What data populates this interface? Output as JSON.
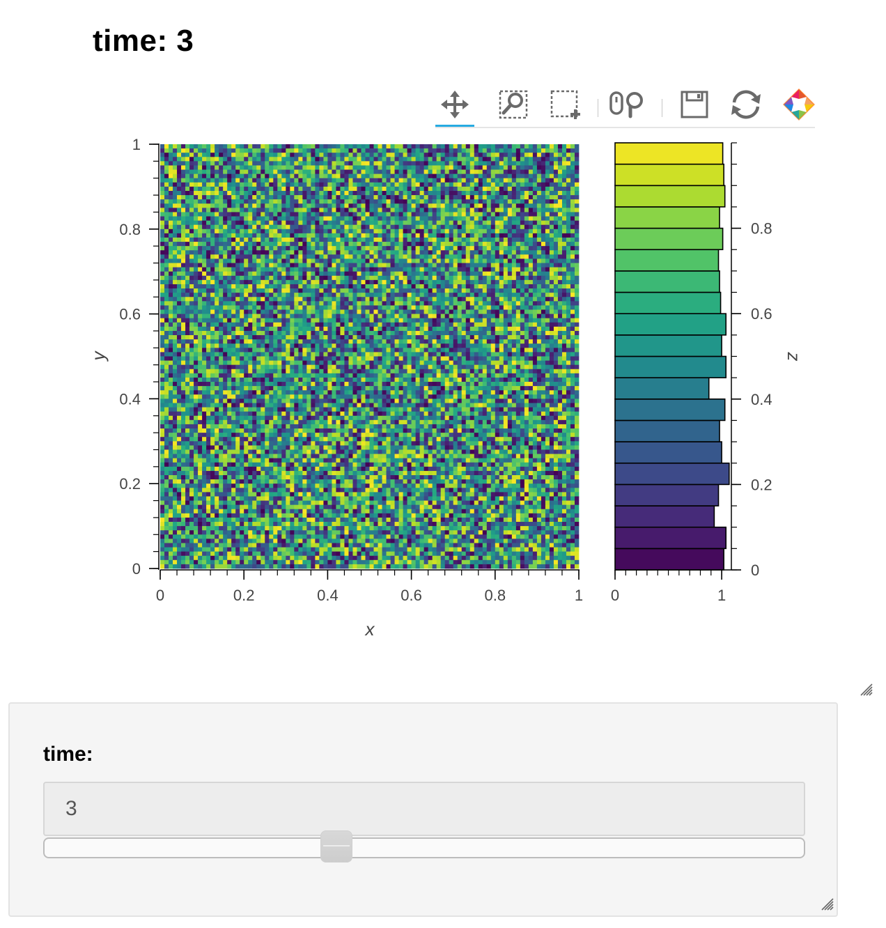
{
  "title": "time: 3",
  "toolbar": {
    "tools": [
      {
        "name": "pan-tool",
        "icon": "pan-icon",
        "active": true
      },
      {
        "name": "box-zoom-tool",
        "icon": "box-zoom-icon",
        "active": false
      },
      {
        "name": "box-select-tool",
        "icon": "box-select-icon",
        "active": false
      },
      {
        "name": "wheel-zoom-tool",
        "icon": "wheel-zoom-icon",
        "active": false
      },
      {
        "name": "save-tool",
        "icon": "save-icon",
        "active": false
      },
      {
        "name": "reset-tool",
        "icon": "reset-icon",
        "active": false
      },
      {
        "name": "bokeh-logo",
        "icon": "bokeh-logo-icon",
        "active": false
      }
    ],
    "active_color": "#26aae1"
  },
  "widget": {
    "label": "time:",
    "value": "3",
    "slider_fraction": 0.38
  },
  "chart_data": [
    {
      "type": "heatmap",
      "xlabel": "x",
      "ylabel": "y",
      "xlim": [
        0,
        1
      ],
      "ylim": [
        0,
        1
      ],
      "x_ticks": [
        "0",
        "0.2",
        "0.4",
        "0.6",
        "0.8",
        "1"
      ],
      "y_ticks": [
        "0",
        "0.2",
        "0.4",
        "0.6",
        "0.8",
        "1"
      ],
      "grid": false,
      "colormap": "viridis",
      "values": "100x100 grid of uniform random values in [0, 1]",
      "seed": 3
    },
    {
      "type": "bar",
      "orientation": "horizontal",
      "ylabel": "z",
      "bin_edges": [
        0,
        0.05,
        0.1,
        0.15,
        0.2,
        0.25,
        0.3,
        0.35,
        0.4,
        0.45,
        0.5,
        0.55,
        0.6,
        0.65,
        0.7,
        0.75,
        0.8,
        0.85,
        0.9,
        0.95,
        1.0
      ],
      "values": [
        1.02,
        1.04,
        0.93,
        0.97,
        1.07,
        1.0,
        0.98,
        1.03,
        0.88,
        1.04,
        1.0,
        1.04,
        0.99,
        0.98,
        0.97,
        1.01,
        0.98,
        1.03,
        1.02,
        1.01
      ],
      "xlim": [
        0,
        1.13
      ],
      "ylim": [
        0,
        1
      ],
      "x_ticks": [
        "0",
        "1"
      ],
      "y_ticks": [
        "0",
        "0.2",
        "0.4",
        "0.6",
        "0.8"
      ],
      "colormap": "viridis"
    }
  ]
}
